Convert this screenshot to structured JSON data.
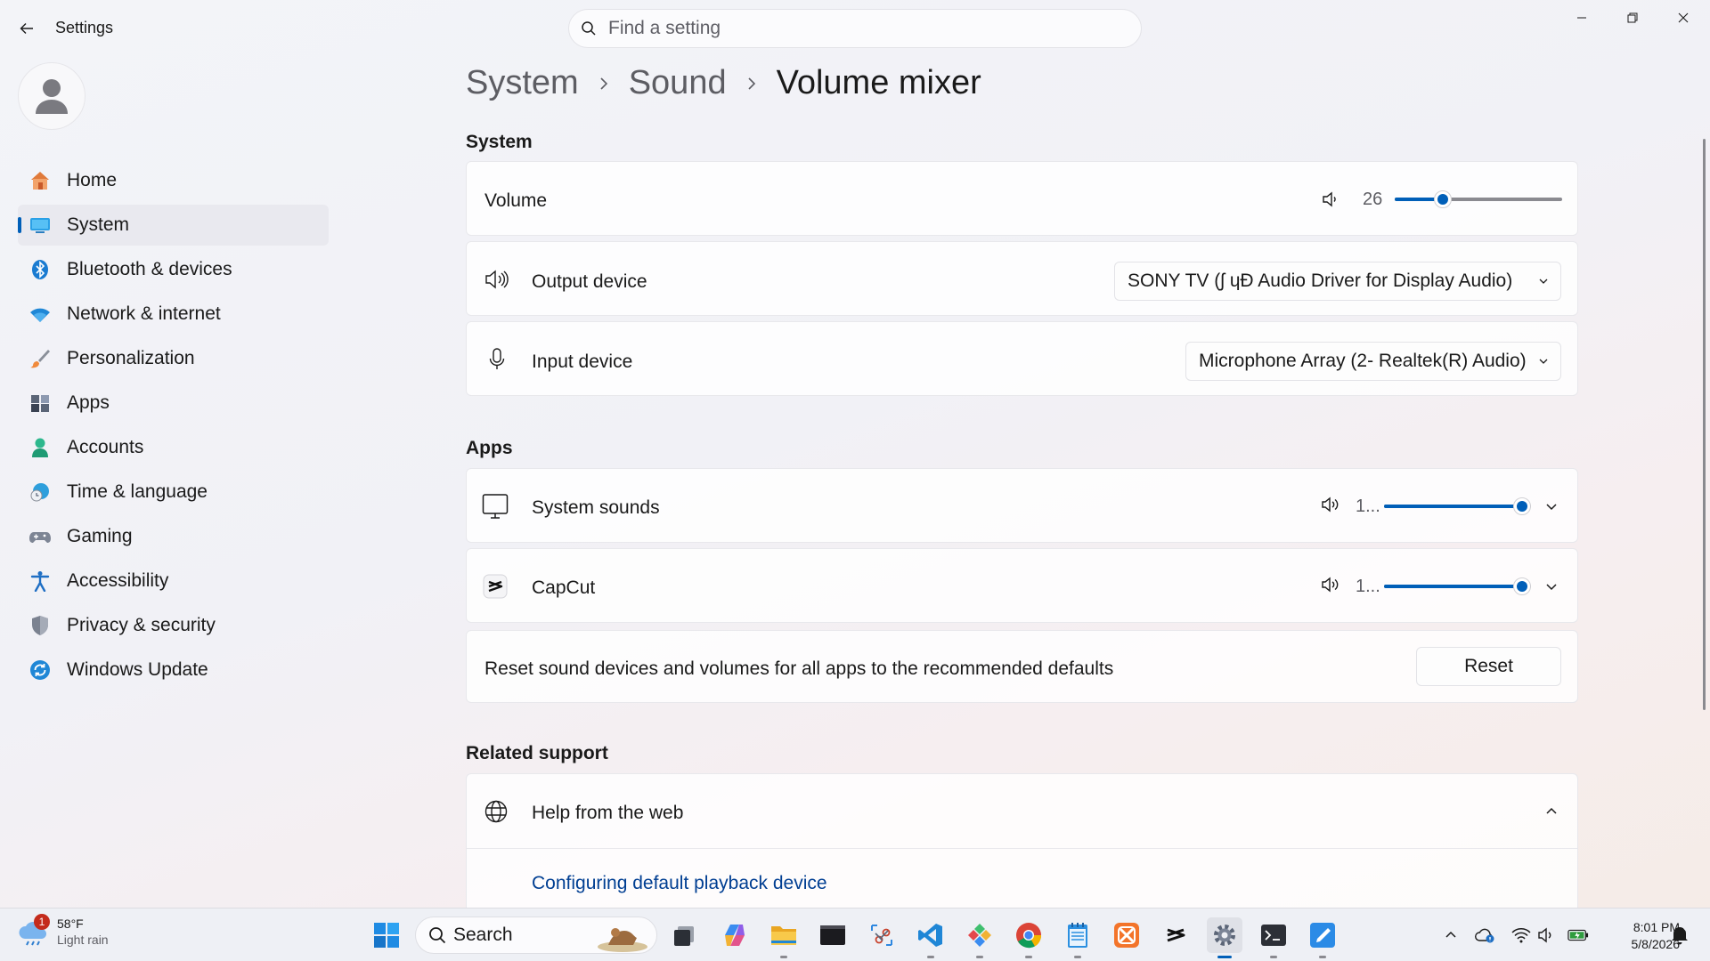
{
  "window": {
    "title": "Settings"
  },
  "search": {
    "placeholder": "Find a setting"
  },
  "sidebar": {
    "items": [
      {
        "label": "Home",
        "icon": "home-icon"
      },
      {
        "label": "System",
        "icon": "system-icon",
        "active": true
      },
      {
        "label": "Bluetooth & devices",
        "icon": "bluetooth-icon"
      },
      {
        "label": "Network & internet",
        "icon": "wifi-icon"
      },
      {
        "label": "Personalization",
        "icon": "brush-icon"
      },
      {
        "label": "Apps",
        "icon": "apps-icon"
      },
      {
        "label": "Accounts",
        "icon": "person-icon"
      },
      {
        "label": "Time & language",
        "icon": "globe-clock-icon"
      },
      {
        "label": "Gaming",
        "icon": "controller-icon"
      },
      {
        "label": "Accessibility",
        "icon": "accessibility-icon"
      },
      {
        "label": "Privacy & security",
        "icon": "shield-icon"
      },
      {
        "label": "Windows Update",
        "icon": "update-icon"
      }
    ]
  },
  "breadcrumb": {
    "items": [
      "System",
      "Sound",
      "Volume mixer"
    ]
  },
  "system_section": {
    "title": "System",
    "volume": {
      "label": "Volume",
      "value_text": "26",
      "level": 0.26
    },
    "output": {
      "label": "Output device",
      "selected": "SONY TV (ʃ  ɥĐ Audio Driver for Display Audio)"
    },
    "input": {
      "label": "Input device",
      "selected": "Microphone Array (2- Realtek(R) Audio)"
    }
  },
  "apps_section": {
    "title": "Apps",
    "items": [
      {
        "label": "System sounds",
        "value_text": "1...",
        "level": 1.0,
        "icon": "monitor-icon"
      },
      {
        "label": "CapCut",
        "value_text": "1...",
        "level": 1.0,
        "icon": "capcut-icon"
      }
    ],
    "reset": {
      "description": "Reset sound devices and volumes for all apps to the recommended defaults",
      "button": "Reset"
    }
  },
  "related": {
    "title": "Related support",
    "help": {
      "label": "Help from the web"
    },
    "links": [
      "Configuring default playback device"
    ]
  },
  "taskbar": {
    "weather": {
      "temp": "58°F",
      "desc": "Light rain",
      "badge": "1"
    },
    "search_label": "Search",
    "clock": {
      "time": "8:01 PM",
      "date": "5/8/2026"
    }
  },
  "colors": {
    "accent": "#005fb8",
    "link": "#003e92"
  }
}
